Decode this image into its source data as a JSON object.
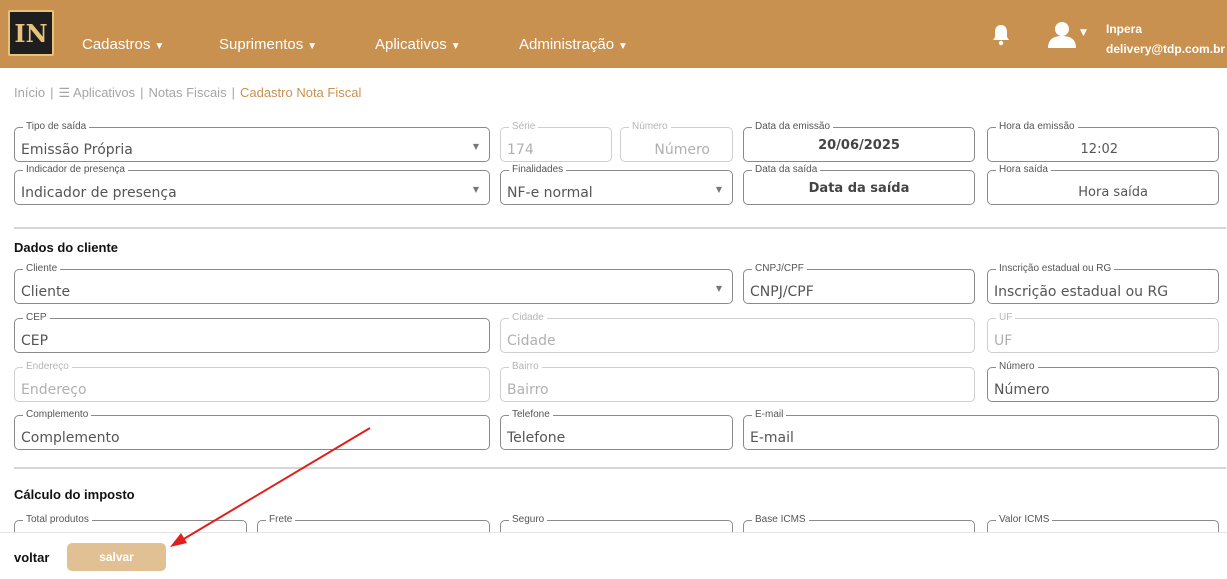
{
  "header": {
    "logo_text": "IN",
    "nav": [
      {
        "label": "Cadastros"
      },
      {
        "label": "Suprimentos"
      },
      {
        "label": "Aplicativos"
      },
      {
        "label": "Administração"
      }
    ],
    "user_name": "Inpera",
    "user_email": "delivery@tdp.com.br",
    "brand_color": "#c8914f"
  },
  "breadcrumb": {
    "inicio": "Início",
    "aplicativos": "☰ Aplicativos",
    "notas": "Notas Fiscais",
    "current": "Cadastro Nota Fiscal",
    "sep": "|"
  },
  "nota": {
    "tipo_saida": {
      "label": "Tipo de saída",
      "value": "Emissão Própria"
    },
    "serie": {
      "label": "Série",
      "value": "174"
    },
    "numero": {
      "label": "Número",
      "placeholder": "Número"
    },
    "data_emissao": {
      "label": "Data da emissão",
      "value": "20/06/2025"
    },
    "hora_emissao": {
      "label": "Hora da emissão",
      "value": "12:02"
    },
    "indicador": {
      "label": "Indicador de presença",
      "placeholder": "Indicador de presença"
    },
    "finalidades": {
      "label": "Finalidades",
      "value": "NF-e normal"
    },
    "data_saida": {
      "label": "Data da saída",
      "placeholder": "Data da saída"
    },
    "hora_saida": {
      "label": "Hora saída",
      "placeholder": "Hora saída"
    }
  },
  "cliente": {
    "section_title": "Dados do cliente",
    "cliente": {
      "label": "Cliente",
      "placeholder": "Cliente"
    },
    "cnpj": {
      "label": "CNPJ/CPF",
      "placeholder": "CNPJ/CPF"
    },
    "ie": {
      "label": "Inscrição estadual ou RG",
      "placeholder": "Inscrição estadual ou RG"
    },
    "cep": {
      "label": "CEP",
      "placeholder": "CEP"
    },
    "cidade": {
      "label": "Cidade",
      "placeholder": "Cidade"
    },
    "uf": {
      "label": "UF",
      "placeholder": "UF"
    },
    "endereco": {
      "label": "Endereço",
      "placeholder": "Endereço"
    },
    "bairro": {
      "label": "Bairro",
      "placeholder": "Bairro"
    },
    "numero": {
      "label": "Número",
      "placeholder": "Número"
    },
    "complemento": {
      "label": "Complemento",
      "placeholder": "Complemento"
    },
    "telefone": {
      "label": "Telefone",
      "placeholder": "Telefone"
    },
    "email": {
      "label": "E-mail",
      "placeholder": "E-mail"
    }
  },
  "imposto": {
    "section_title": "Cálculo do imposto",
    "total_produtos": {
      "label": "Total produtos"
    },
    "frete": {
      "label": "Frete"
    },
    "seguro": {
      "label": "Seguro"
    },
    "base_icms": {
      "label": "Base ICMS"
    },
    "valor_icms": {
      "label": "Valor ICMS"
    }
  },
  "footer": {
    "voltar": "voltar",
    "salvar": "salvar"
  },
  "annotation_color": "#e0201b"
}
